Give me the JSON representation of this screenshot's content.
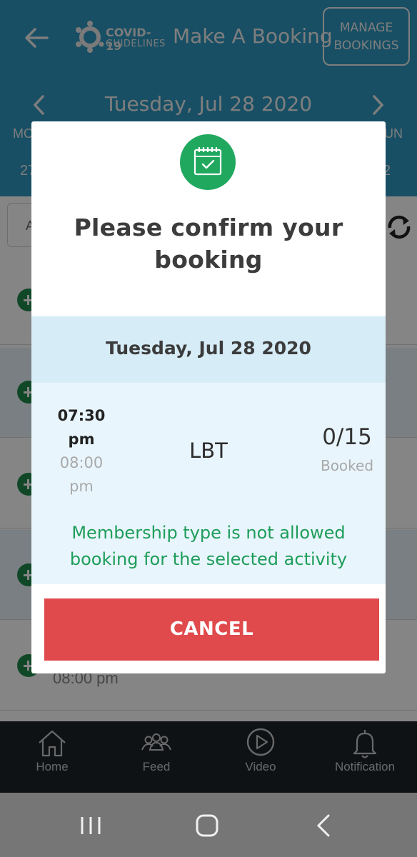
{
  "header": {
    "logo_line1": "COVID-19",
    "logo_line2": "GUIDELINES",
    "title": "Make A Booking",
    "manage_line1": "MANAGE",
    "manage_line2": "BOOKINGS",
    "date": "Tuesday, Jul 28 2020",
    "day_left": "MO",
    "day_right": "UN",
    "num_left": "27",
    "num_right": "2"
  },
  "filter": {
    "partial_text": "A"
  },
  "list": {
    "visible_time": "08:00 pm"
  },
  "modal": {
    "icon": "calendar-check-icon",
    "heading_line1": "Please confirm your",
    "heading_line2": "booking",
    "date": "Tuesday, Jul 28 2020",
    "start_time_line1": "07:30",
    "start_time_line2": "pm",
    "end_time_line1": "08:00",
    "end_time_line2": "pm",
    "activity": "LBT",
    "capacity": "0/15",
    "capacity_label": "Booked",
    "warning_line1": "Membership type is not allowed",
    "warning_line2": "booking for the selected activity",
    "cancel_label": "CANCEL"
  },
  "bottom_nav": [
    {
      "label": "Home",
      "icon": "home-icon"
    },
    {
      "label": "Feed",
      "icon": "feed-icon"
    },
    {
      "label": "Video",
      "icon": "video-icon"
    },
    {
      "label": "Notification",
      "icon": "bell-icon"
    }
  ],
  "colors": {
    "header": "#2f98c0",
    "success_green": "#20a85f",
    "cancel_red": "#e04a4c",
    "nav_dark": "#1e2329"
  }
}
